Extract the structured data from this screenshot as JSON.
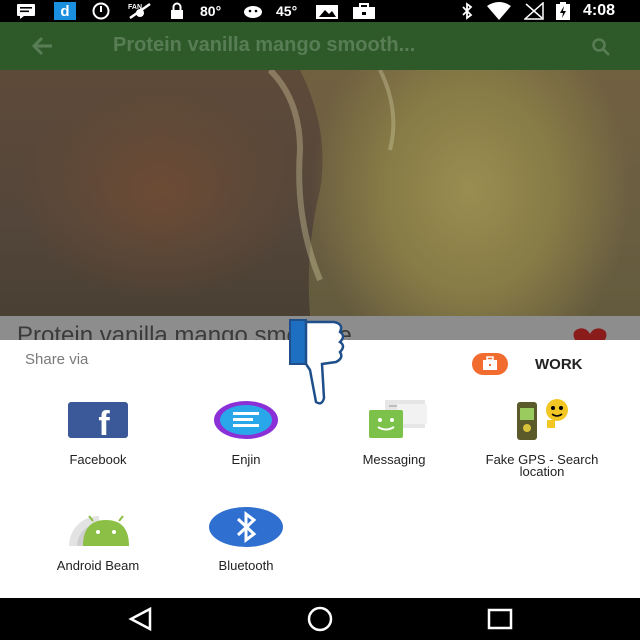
{
  "status_bar": {
    "temp1": "80°",
    "temp2": "45°",
    "time": "4:08",
    "icons": [
      "message-icon",
      "d-app-icon",
      "alarm-icon",
      "no-fan-icon",
      "lock-icon",
      "cloud-icon",
      "cloud-icon",
      "photo-icon",
      "briefcase-icon",
      "bluetooth-icon",
      "wifi-icon",
      "no-signal-icon",
      "battery-charging-icon"
    ]
  },
  "app_bar": {
    "title": "Protein vanilla mango smooth...",
    "icons": [
      "back-arrow-icon",
      "search-icon"
    ]
  },
  "recipe": {
    "title": "Protein vanilla mango smoothie"
  },
  "share_sheet": {
    "label": "Share via",
    "work_label": "WORK",
    "apps": [
      {
        "name": "Facebook",
        "icon": "facebook-icon"
      },
      {
        "name": "Enjin",
        "icon": "enjin-icon"
      },
      {
        "name": "Messaging",
        "icon": "messaging-icon"
      },
      {
        "name": "Fake GPS - Search location",
        "icon": "fake-gps-icon"
      },
      {
        "name": "Android Beam",
        "icon": "android-beam-icon"
      },
      {
        "name": "Bluetooth",
        "icon": "bluetooth-icon"
      }
    ]
  },
  "nav_bar": {
    "icons": [
      "back-triangle-icon",
      "home-circle-icon",
      "recents-square-icon"
    ]
  },
  "colors": {
    "appbar": "#2e5a2a",
    "work_accent": "#f36c2f",
    "facebook": "#3b5998",
    "bluetooth": "#2f6fcf"
  }
}
